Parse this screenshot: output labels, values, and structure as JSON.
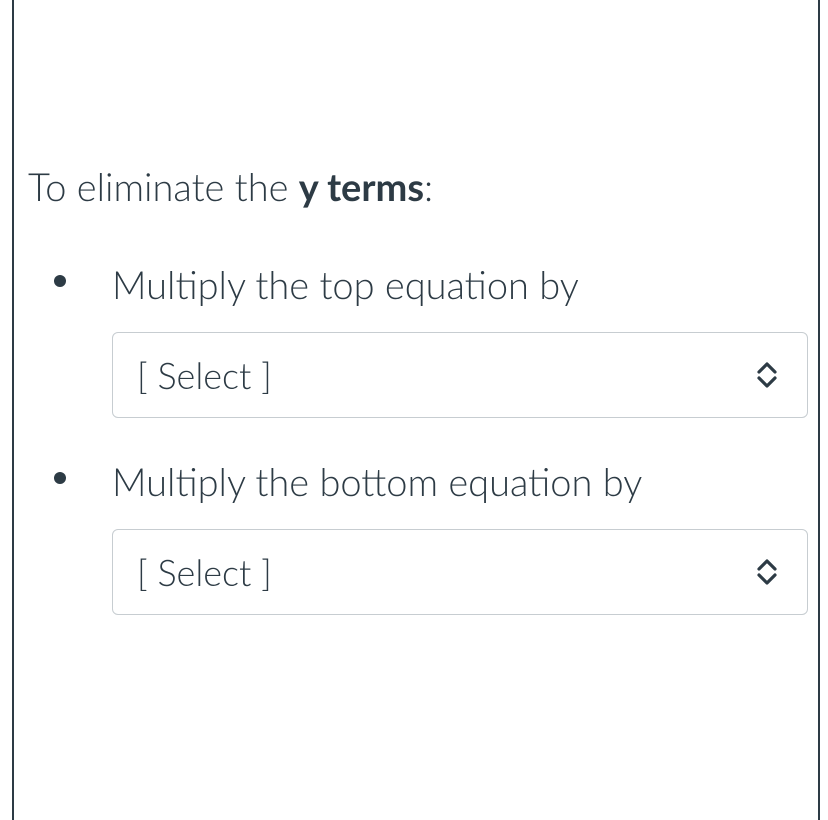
{
  "intro": {
    "prefix": "To eliminate the ",
    "bold": "y terms",
    "suffix": ":"
  },
  "bullets": [
    {
      "text": "Multiply the top equation by",
      "select_placeholder": "[ Select ]"
    },
    {
      "text": "Multiply the bottom equation by",
      "select_placeholder": "[ Select ]"
    }
  ]
}
